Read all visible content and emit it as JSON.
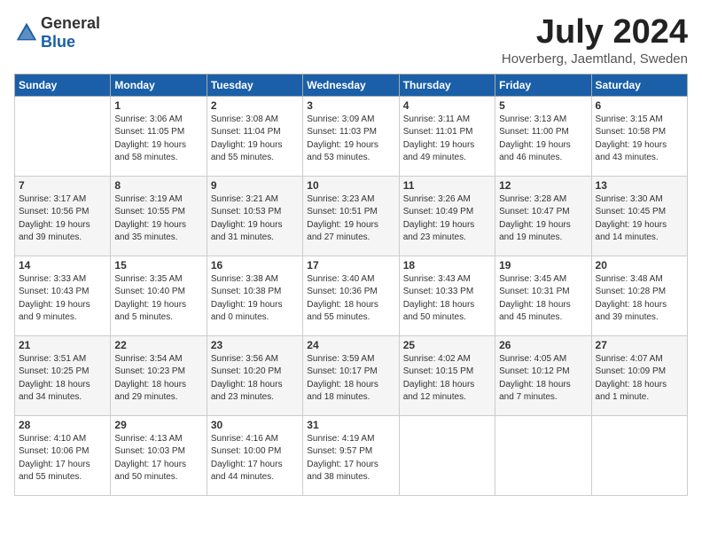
{
  "header": {
    "logo_general": "General",
    "logo_blue": "Blue",
    "month_year": "July 2024",
    "location": "Hoverberg, Jaemtland, Sweden"
  },
  "weekdays": [
    "Sunday",
    "Monday",
    "Tuesday",
    "Wednesday",
    "Thursday",
    "Friday",
    "Saturday"
  ],
  "weeks": [
    [
      {
        "day": "",
        "info": ""
      },
      {
        "day": "1",
        "info": "Sunrise: 3:06 AM\nSunset: 11:05 PM\nDaylight: 19 hours\nand 58 minutes."
      },
      {
        "day": "2",
        "info": "Sunrise: 3:08 AM\nSunset: 11:04 PM\nDaylight: 19 hours\nand 55 minutes."
      },
      {
        "day": "3",
        "info": "Sunrise: 3:09 AM\nSunset: 11:03 PM\nDaylight: 19 hours\nand 53 minutes."
      },
      {
        "day": "4",
        "info": "Sunrise: 3:11 AM\nSunset: 11:01 PM\nDaylight: 19 hours\nand 49 minutes."
      },
      {
        "day": "5",
        "info": "Sunrise: 3:13 AM\nSunset: 11:00 PM\nDaylight: 19 hours\nand 46 minutes."
      },
      {
        "day": "6",
        "info": "Sunrise: 3:15 AM\nSunset: 10:58 PM\nDaylight: 19 hours\nand 43 minutes."
      }
    ],
    [
      {
        "day": "7",
        "info": "Sunrise: 3:17 AM\nSunset: 10:56 PM\nDaylight: 19 hours\nand 39 minutes."
      },
      {
        "day": "8",
        "info": "Sunrise: 3:19 AM\nSunset: 10:55 PM\nDaylight: 19 hours\nand 35 minutes."
      },
      {
        "day": "9",
        "info": "Sunrise: 3:21 AM\nSunset: 10:53 PM\nDaylight: 19 hours\nand 31 minutes."
      },
      {
        "day": "10",
        "info": "Sunrise: 3:23 AM\nSunset: 10:51 PM\nDaylight: 19 hours\nand 27 minutes."
      },
      {
        "day": "11",
        "info": "Sunrise: 3:26 AM\nSunset: 10:49 PM\nDaylight: 19 hours\nand 23 minutes."
      },
      {
        "day": "12",
        "info": "Sunrise: 3:28 AM\nSunset: 10:47 PM\nDaylight: 19 hours\nand 19 minutes."
      },
      {
        "day": "13",
        "info": "Sunrise: 3:30 AM\nSunset: 10:45 PM\nDaylight: 19 hours\nand 14 minutes."
      }
    ],
    [
      {
        "day": "14",
        "info": "Sunrise: 3:33 AM\nSunset: 10:43 PM\nDaylight: 19 hours\nand 9 minutes."
      },
      {
        "day": "15",
        "info": "Sunrise: 3:35 AM\nSunset: 10:40 PM\nDaylight: 19 hours\nand 5 minutes."
      },
      {
        "day": "16",
        "info": "Sunrise: 3:38 AM\nSunset: 10:38 PM\nDaylight: 19 hours\nand 0 minutes."
      },
      {
        "day": "17",
        "info": "Sunrise: 3:40 AM\nSunset: 10:36 PM\nDaylight: 18 hours\nand 55 minutes."
      },
      {
        "day": "18",
        "info": "Sunrise: 3:43 AM\nSunset: 10:33 PM\nDaylight: 18 hours\nand 50 minutes."
      },
      {
        "day": "19",
        "info": "Sunrise: 3:45 AM\nSunset: 10:31 PM\nDaylight: 18 hours\nand 45 minutes."
      },
      {
        "day": "20",
        "info": "Sunrise: 3:48 AM\nSunset: 10:28 PM\nDaylight: 18 hours\nand 39 minutes."
      }
    ],
    [
      {
        "day": "21",
        "info": "Sunrise: 3:51 AM\nSunset: 10:25 PM\nDaylight: 18 hours\nand 34 minutes."
      },
      {
        "day": "22",
        "info": "Sunrise: 3:54 AM\nSunset: 10:23 PM\nDaylight: 18 hours\nand 29 minutes."
      },
      {
        "day": "23",
        "info": "Sunrise: 3:56 AM\nSunset: 10:20 PM\nDaylight: 18 hours\nand 23 minutes."
      },
      {
        "day": "24",
        "info": "Sunrise: 3:59 AM\nSunset: 10:17 PM\nDaylight: 18 hours\nand 18 minutes."
      },
      {
        "day": "25",
        "info": "Sunrise: 4:02 AM\nSunset: 10:15 PM\nDaylight: 18 hours\nand 12 minutes."
      },
      {
        "day": "26",
        "info": "Sunrise: 4:05 AM\nSunset: 10:12 PM\nDaylight: 18 hours\nand 7 minutes."
      },
      {
        "day": "27",
        "info": "Sunrise: 4:07 AM\nSunset: 10:09 PM\nDaylight: 18 hours\nand 1 minute."
      }
    ],
    [
      {
        "day": "28",
        "info": "Sunrise: 4:10 AM\nSunset: 10:06 PM\nDaylight: 17 hours\nand 55 minutes."
      },
      {
        "day": "29",
        "info": "Sunrise: 4:13 AM\nSunset: 10:03 PM\nDaylight: 17 hours\nand 50 minutes."
      },
      {
        "day": "30",
        "info": "Sunrise: 4:16 AM\nSunset: 10:00 PM\nDaylight: 17 hours\nand 44 minutes."
      },
      {
        "day": "31",
        "info": "Sunrise: 4:19 AM\nSunset: 9:57 PM\nDaylight: 17 hours\nand 38 minutes."
      },
      {
        "day": "",
        "info": ""
      },
      {
        "day": "",
        "info": ""
      },
      {
        "day": "",
        "info": ""
      }
    ]
  ]
}
